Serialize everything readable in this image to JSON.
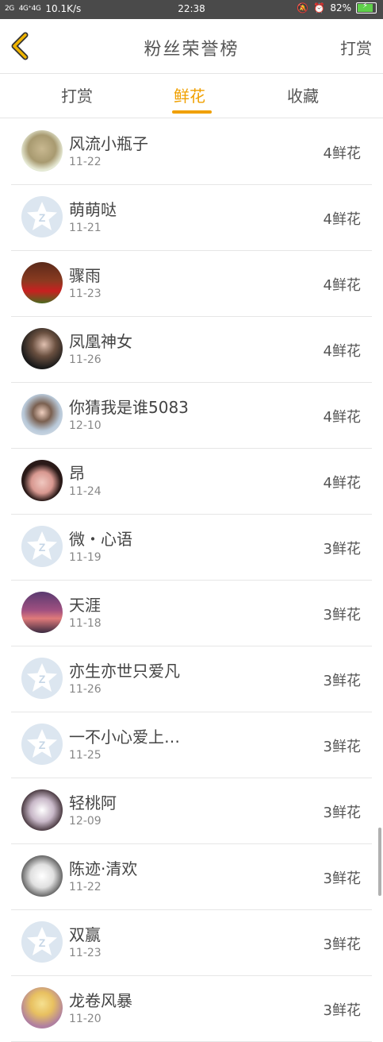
{
  "status": {
    "network": "2G",
    "network2": "4G⁺4G",
    "speed": "10.1K/s",
    "time": "22:38",
    "battery": "82%",
    "battery_level": 0.82
  },
  "header": {
    "title": "粉丝荣誉榜",
    "action": "打赏"
  },
  "tabs": [
    {
      "label": "打赏",
      "active": false
    },
    {
      "label": "鲜花",
      "active": true
    },
    {
      "label": "收藏",
      "active": false
    }
  ],
  "rows": [
    {
      "name": "风流小瓶子",
      "date": "11-22",
      "count": "4鲜花"
    },
    {
      "name": "萌萌哒",
      "date": "11-21",
      "count": "4鲜花"
    },
    {
      "name": "骤雨",
      "date": "11-23",
      "count": "4鲜花"
    },
    {
      "name": "凤凰神女",
      "date": "11-26",
      "count": "4鲜花"
    },
    {
      "name": "你猜我是谁5083",
      "date": "12-10",
      "count": "4鲜花"
    },
    {
      "name": "昂",
      "date": "11-24",
      "count": "4鲜花"
    },
    {
      "name": "微・心语",
      "date": "11-19",
      "count": "3鲜花"
    },
    {
      "name": "天涯",
      "date": "11-18",
      "count": "3鲜花"
    },
    {
      "name": "亦生亦世只爱凡",
      "date": "11-26",
      "count": "3鲜花"
    },
    {
      "name": "一不小心爱上…",
      "date": "11-25",
      "count": "3鲜花"
    },
    {
      "name": "轻桃阿",
      "date": "12-09",
      "count": "3鲜花"
    },
    {
      "name": "陈迹·清欢",
      "date": "11-22",
      "count": "3鲜花"
    },
    {
      "name": "双赢",
      "date": "11-23",
      "count": "3鲜花"
    },
    {
      "name": "龙卷风暴",
      "date": "11-20",
      "count": "3鲜花"
    }
  ],
  "colors": {
    "accent": "#f0a000",
    "status_bar": "#4a4a4a",
    "battery_fill": "#5fd04a",
    "default_avatar": "#dce6f0"
  }
}
